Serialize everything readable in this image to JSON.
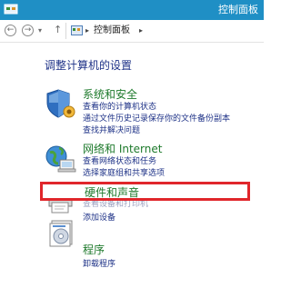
{
  "window": {
    "title": "控制面板"
  },
  "address": {
    "back_glyph": "←",
    "forward_glyph": "→",
    "recent_glyph": "▾",
    "up_glyph": "↑",
    "crumb_sep": "▸",
    "crumb": "控制面板"
  },
  "main": {
    "heading": "调整计算机的设置",
    "categories": [
      {
        "title": "系统和安全",
        "icon": "shield-icon",
        "links": [
          "查看你的计算机状态",
          "通过文件历史记录保存你的文件备份副本",
          "查找并解决问题"
        ]
      },
      {
        "title": "网络和 Internet",
        "icon": "network-icon",
        "links": [
          "查看网络状态和任务",
          "选择家庭组和共享选项"
        ]
      },
      {
        "title": "硬件和声音",
        "icon": "printer-icon",
        "links": [
          "查看设备和打印机",
          "添加设备"
        ]
      },
      {
        "title": "程序",
        "icon": "programs-icon",
        "links": [
          "卸载程序"
        ]
      }
    ]
  },
  "colors": {
    "titlebar": "#1f8fc5",
    "heading": "#1e3287",
    "category_title": "#1e7a2c",
    "link": "#1e3287",
    "highlight": "#e0262b"
  }
}
